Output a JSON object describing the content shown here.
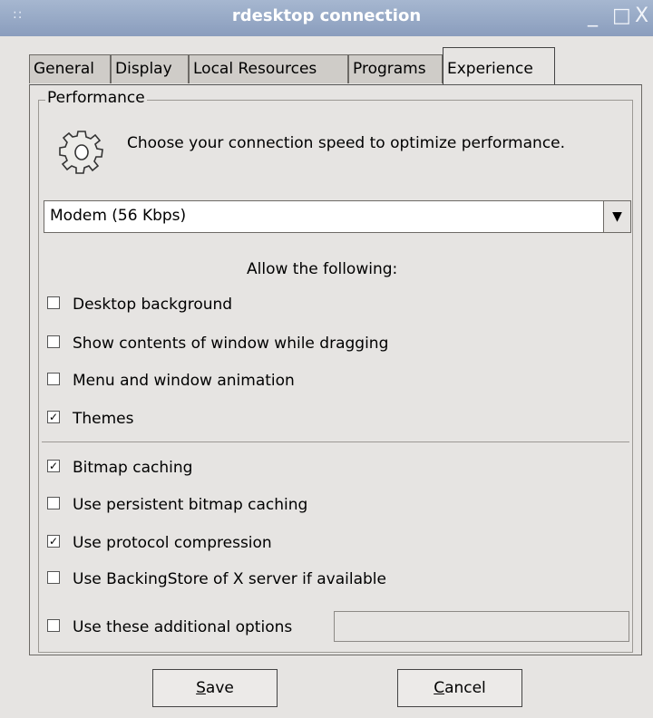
{
  "window": {
    "title": "rdesktop connection",
    "grip_glyph": "::",
    "minimize_glyph": "_",
    "maximize_glyph": "□",
    "close_glyph": "X"
  },
  "tabs": [
    {
      "label": "General"
    },
    {
      "label": "Display"
    },
    {
      "label": "Local Resources"
    },
    {
      "label": "Programs"
    },
    {
      "label": "Experience"
    }
  ],
  "active_tab": "Experience",
  "performance": {
    "group_title": "Performance",
    "icon": "gear-icon",
    "description": "Choose your connection speed to optimize performance.",
    "speed_value": "Modem (56 Kbps)",
    "allow_label": "Allow the following:"
  },
  "options_visual": [
    {
      "label": "Desktop background",
      "checked": false
    },
    {
      "label": "Show contents of window while dragging",
      "checked": false
    },
    {
      "label": "Menu and window animation",
      "checked": false
    },
    {
      "label": "Themes",
      "checked": true
    }
  ],
  "options_cache": [
    {
      "label": "Bitmap caching",
      "checked": true
    },
    {
      "label": "Use persistent bitmap caching",
      "checked": false
    },
    {
      "label": "Use protocol compression",
      "checked": true
    },
    {
      "label": "Use BackingStore of X server if available",
      "checked": false
    }
  ],
  "additional": {
    "label": "Use these additional options",
    "checked": false,
    "value": ""
  },
  "buttons": {
    "save_mnemonic": "S",
    "save_rest": "ave",
    "cancel_mnemonic": "C",
    "cancel_rest": "ancel"
  },
  "colors": {
    "titlebar": "#8a9dbd",
    "background": "#e6e4e2"
  }
}
